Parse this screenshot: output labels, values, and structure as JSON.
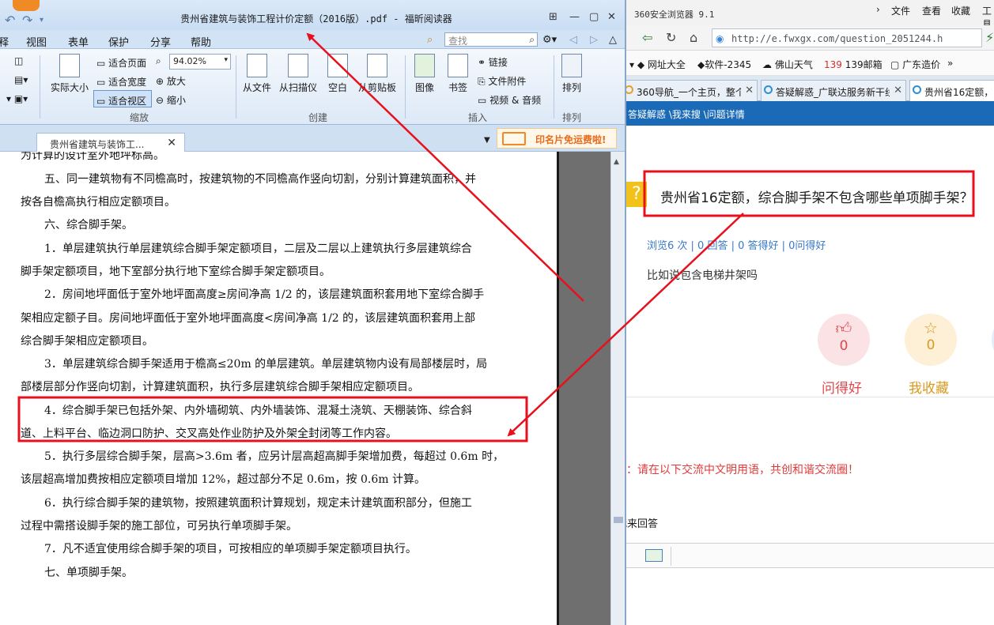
{
  "reader": {
    "window_title": "贵州省建筑与装饰工程计价定额（2016版）.pdf - 福昕阅读器",
    "menu": [
      "释",
      "视图",
      "表单",
      "保护",
      "分享",
      "帮助"
    ],
    "search_placeholder": "查找",
    "ribbon": {
      "actual_size": "实际大小",
      "fit_page": "适合页面",
      "fit_width": "适合宽度",
      "fit_view": "适合视区",
      "zoom_value": "94.02%",
      "zoom_in": "放大",
      "zoom_out": "缩小",
      "group_zoom": "缩放",
      "from_file": "从文件",
      "from_scanner": "从扫描仪",
      "blank": "空白",
      "from_clipboard": "从剪贴板",
      "group_create": "创建",
      "image": "图像",
      "bookmark": "书签",
      "link": "链接",
      "file_attachment": "文件附件",
      "video_audio": "视频 & 音频",
      "group_insert": "插入",
      "arrange": "排列",
      "group_arrange": "排列"
    },
    "tab_label": "贵州省建筑与装饰工...",
    "promo": "印名片免运费啦!",
    "doc_lines": [
      "为计算的设计室外地坪标高。",
      "五、同一建筑物有不同檐高时，按建筑物的不同檐高作竖向切割，分别计算建筑面积，并",
      "按各自檐高执行相应定额项目。",
      "六、综合脚手架。",
      "1．单层建筑执行单层建筑综合脚手架定额项目，二层及二层以上建筑执行多层建筑综合",
      "脚手架定额项目，地下室部分执行地下室综合脚手架定额项目。",
      "2．房间地坪面低于室外地坪面高度≥房间净高 1/2 的，该层建筑面积套用地下室综合脚手",
      "架相应定额子目。房间地坪面低于室外地坪面高度<房间净高 1/2 的，该层建筑面积套用上部",
      "综合脚手架相应定额项目。",
      "3．单层建筑综合脚手架适用于檐高≤20m 的单层建筑。单层建筑物内设有局部楼层时，局",
      "部楼层部分作竖向切割，计算建筑面积，执行多层建筑综合脚手架相应定额项目。",
      "4．综合脚手架已包括外架、内外墙砌筑、内外墙装饰、混凝土浇筑、天棚装饰、综合斜",
      "道、上料平台、临边洞口防护、交叉高处作业防护及外架全封闭等工作内容。",
      "5．执行多层综合脚手架，层高>3.6m 者，应另计层高超高脚手架增加费，每超过 0.6m 时，",
      "该层超高增加费按相应定额项目增加 12%，超过部分不足 0.6m，按 0.6m 计算。",
      "6．执行综合脚手架的建筑物，按照建筑面积计算规划，规定未计建筑面积部分，但施工",
      "过程中需搭设脚手架的施工部位，可另执行单项脚手架。",
      "7．凡不适宜使用综合脚手架的项目，可按相应的单项脚手架定额项目执行。",
      "七、单项脚手架。"
    ]
  },
  "browser": {
    "title": "360安全浏览器 9.1",
    "menu": [
      "文件",
      "查看",
      "收藏",
      "工具"
    ],
    "url": "http://e.fwxgx.com/question_2051244.h",
    "bookmarks": [
      "网址大全",
      "软件-2345",
      "佛山天气",
      "139邮箱",
      "广东造价",
      "»"
    ],
    "tabs": [
      "360导航_一个主页，整个世界",
      "答疑解惑_广联达服务新干线",
      "贵州省16定额，"
    ],
    "breadcrumb": "答疑解惑 \\我来搜 \\问题详情",
    "question_icon": "?",
    "question": "贵州省16定额，综合脚手架不包含哪些单项脚手架？",
    "stats": "浏览6 次 | 0 回答 | 0 答得好 | 0问得好",
    "detail": "比如说包含电梯井架吗",
    "like_count": "0",
    "like_label": "问得好",
    "fav_count": "0",
    "fav_label": "我收藏",
    "notice": "：请在以下交流中文明用语，共创和谐交流圈！",
    "answer_label": "我来回答"
  },
  "colors": {
    "annotation": "#e8101c",
    "reader_chrome": "#cfe0f3",
    "browser_crumb_bar": "#1a6ab8",
    "like_color": "#e0484e",
    "fav_color": "#d99a1e"
  }
}
